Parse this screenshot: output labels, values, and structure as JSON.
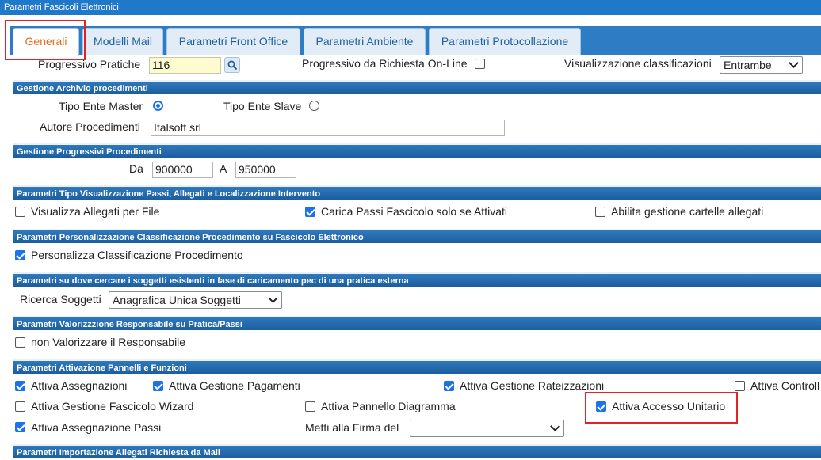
{
  "window": {
    "title": "Parametri Fascicoli Elettronici"
  },
  "tabs": [
    {
      "label": "Generali",
      "active": true
    },
    {
      "label": "Modelli Mail",
      "active": false
    },
    {
      "label": "Parametri Front Office",
      "active": false
    },
    {
      "label": "Parametri Ambiente",
      "active": false
    },
    {
      "label": "Parametri Protocollazione",
      "active": false
    }
  ],
  "top": {
    "progressivo_label": "Progressivo Pratiche",
    "progressivo_value": "116",
    "search_icon": "search-icon",
    "online_label": "Progressivo da Richiesta On-Line",
    "online_checked": false,
    "visualizzazione_label": "Visualizzazione classificazioni",
    "visualizzazione_value": "Entrambe"
  },
  "archivio": {
    "title": "Gestione Archivio procedimenti",
    "master_label": "Tipo Ente Master",
    "master_checked": true,
    "slave_label": "Tipo Ente Slave",
    "slave_checked": false,
    "autore_label": "Autore Procedimenti",
    "autore_value": "Italsoft srl"
  },
  "progressivi": {
    "title": "Gestione Progressivi Procedimenti",
    "da_label": "Da",
    "da_value": "900000",
    "a_label": "A",
    "a_value": "950000"
  },
  "visualizzazione": {
    "title": "Parametri Tipo Visualizzazione Passi, Allegati e Localizzazione Intervento",
    "allegati_label": "Visualizza Allegati per File",
    "allegati_checked": false,
    "passi_label": "Carica Passi Fascicolo solo se Attivati",
    "passi_checked": true,
    "cartelle_label": "Abilita gestione cartelle allegati",
    "cartelle_checked": false
  },
  "personalizzazione": {
    "title": "Parametri Personalizzazione Classificazione Procedimento su Fascicolo Elettronico",
    "label": "Personalizza Classificazione Procedimento",
    "checked": true
  },
  "soggetti": {
    "title": "Parametri su dove cercare i soggetti esistenti in fase di caricamento pec di una pratica esterna",
    "label": "Ricerca Soggetti",
    "value": "Anagrafica Unica Soggetti"
  },
  "responsabile": {
    "title": "Parametri Valorizzzione Responsabile su Pratica/Passi",
    "label": "non Valorizzare il Responsabile",
    "checked": false
  },
  "attivazione": {
    "title": "Parametri Attivazione Pannelli e Funzioni",
    "assegnazioni_label": "Attiva Assegnazioni",
    "assegnazioni_checked": true,
    "pagamenti_label": "Attiva Gestione Pagamenti",
    "pagamenti_checked": true,
    "rateizzazioni_label": "Attiva Gestione Rateizzazioni",
    "rateizzazioni_checked": true,
    "controlli_label": "Attiva Controll",
    "controlli_checked": false,
    "wizard_label": "Attiva Gestione Fascicolo Wizard",
    "wizard_checked": false,
    "diagramma_label": "Attiva Pannello Diagramma",
    "diagramma_checked": false,
    "unitario_label": "Attiva Accesso Unitario",
    "unitario_checked": true,
    "passi_label": "Attiva Assegnazione Passi",
    "passi_checked": true,
    "firma_label": "Metti alla Firma del",
    "firma_value": ""
  },
  "importazione": {
    "title": "Parametri Importazione Allegati Richiesta da Mail"
  },
  "colors": {
    "titlebar": "#1f78c8",
    "section_header": "#2f79bd",
    "active_tab_text": "#e36c1e",
    "highlight": "#e02424",
    "checkbox": "#1a73e8"
  }
}
